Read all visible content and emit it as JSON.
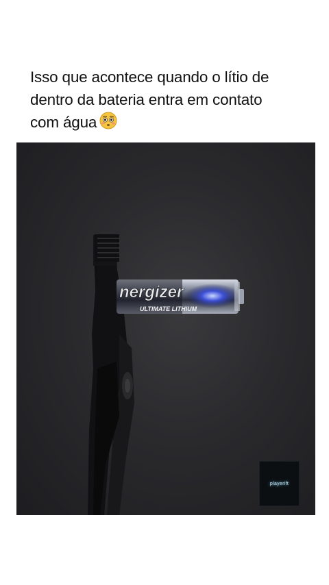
{
  "post": {
    "caption_lines": [
      "Isso que acontece quando o lítio de",
      "dentro da bateria entra em contato",
      "com água"
    ],
    "emoji": "flushed-face-emoji"
  },
  "video": {
    "battery_brand": "nergizer",
    "battery_subtitle": "ULTIMATE LITHIUM",
    "watermark_text": "playerift"
  },
  "colors": {
    "background": "#ffffff",
    "caption_text": "#111111",
    "video_background": "#2a2a2d",
    "emoji_face": "#f5c542"
  }
}
